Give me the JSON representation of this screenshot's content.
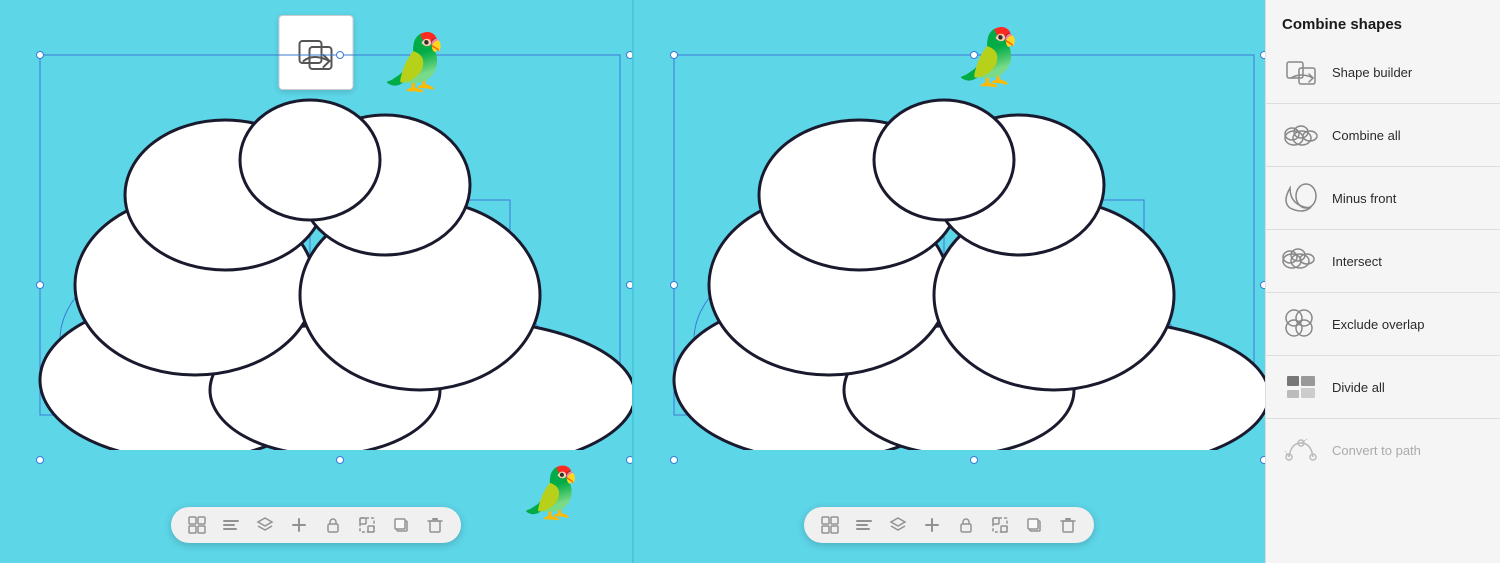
{
  "sidebar": {
    "title": "Combine shapes",
    "items": [
      {
        "id": "shape-builder",
        "label": "Shape builder",
        "icon": "shape-builder",
        "disabled": false,
        "active": false
      },
      {
        "id": "combine-all",
        "label": "Combine all",
        "icon": "combine-all",
        "disabled": false,
        "active": false
      },
      {
        "id": "minus-front",
        "label": "Minus front",
        "icon": "minus-front",
        "disabled": false,
        "active": false
      },
      {
        "id": "intersect",
        "label": "Intersect",
        "icon": "intersect",
        "disabled": false,
        "active": false
      },
      {
        "id": "exclude-overlap",
        "label": "Exclude overlap",
        "icon": "exclude-overlap",
        "disabled": false,
        "active": false
      },
      {
        "id": "divide-all",
        "label": "Divide all",
        "icon": "divide-all",
        "disabled": false,
        "active": false
      },
      {
        "id": "convert-to-path",
        "label": "Convert to path",
        "icon": "convert-to-path",
        "disabled": true,
        "active": false
      }
    ]
  },
  "toolbar": {
    "icons": [
      "grid",
      "align",
      "layers",
      "add",
      "unlock",
      "group",
      "duplicate",
      "delete"
    ]
  },
  "panels": [
    {
      "id": "left-panel",
      "showShapeBuilderIcon": true
    },
    {
      "id": "right-panel",
      "showShapeBuilderIcon": false
    }
  ]
}
